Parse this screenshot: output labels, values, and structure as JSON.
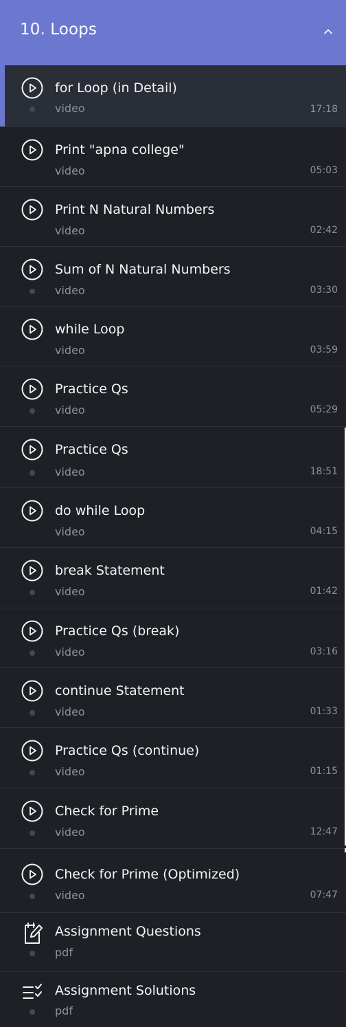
{
  "section": {
    "title": "10. Loops",
    "toggle_icon": "chevron-up-icon"
  },
  "colors": {
    "header_bg": "#6c77d0",
    "list_bg": "#1e2026",
    "active_bg": "#2a2e37",
    "active_accent": "#6c77d0",
    "text": "#f3f4f6",
    "muted": "#8d919a"
  },
  "lessons": [
    {
      "title": "for Loop (in Detail)",
      "type": "video",
      "duration": "17:18",
      "icon": "play-circle-icon",
      "active": true
    },
    {
      "title": "Print \"apna college\"",
      "type": "video",
      "duration": "05:03",
      "icon": "play-circle-icon"
    },
    {
      "title": "Print N Natural Numbers",
      "type": "video",
      "duration": "02:42",
      "icon": "play-circle-icon"
    },
    {
      "title": "Sum of N Natural Numbers",
      "type": "video",
      "duration": "03:30",
      "icon": "play-circle-icon"
    },
    {
      "title": "while Loop",
      "type": "video",
      "duration": "03:59",
      "icon": "play-circle-icon"
    },
    {
      "title": "Practice Qs",
      "type": "video",
      "duration": "05:29",
      "icon": "play-circle-icon"
    },
    {
      "title": "Practice Qs",
      "type": "video",
      "duration": "18:51",
      "icon": "play-circle-icon"
    },
    {
      "title": "do while Loop",
      "type": "video",
      "duration": "04:15",
      "icon": "play-circle-icon"
    },
    {
      "title": "break Statement",
      "type": "video",
      "duration": "01:42",
      "icon": "play-circle-icon"
    },
    {
      "title": "Practice Qs (break)",
      "type": "video",
      "duration": "03:16",
      "icon": "play-circle-icon"
    },
    {
      "title": "continue Statement",
      "type": "video",
      "duration": "01:33",
      "icon": "play-circle-icon"
    },
    {
      "title": "Practice Qs (continue)",
      "type": "video",
      "duration": "01:15",
      "icon": "play-circle-icon"
    },
    {
      "title": "Check for Prime",
      "type": "video",
      "duration": "12:47",
      "icon": "play-circle-icon"
    },
    {
      "title": "Check for Prime (Optimized)",
      "type": "video",
      "duration": "07:47",
      "icon": "play-circle-icon"
    },
    {
      "title": "Assignment Questions",
      "type": "pdf",
      "duration": "",
      "icon": "edit-document-icon"
    },
    {
      "title": "Assignment Solutions",
      "type": "pdf",
      "duration": "",
      "icon": "checklist-icon"
    }
  ]
}
